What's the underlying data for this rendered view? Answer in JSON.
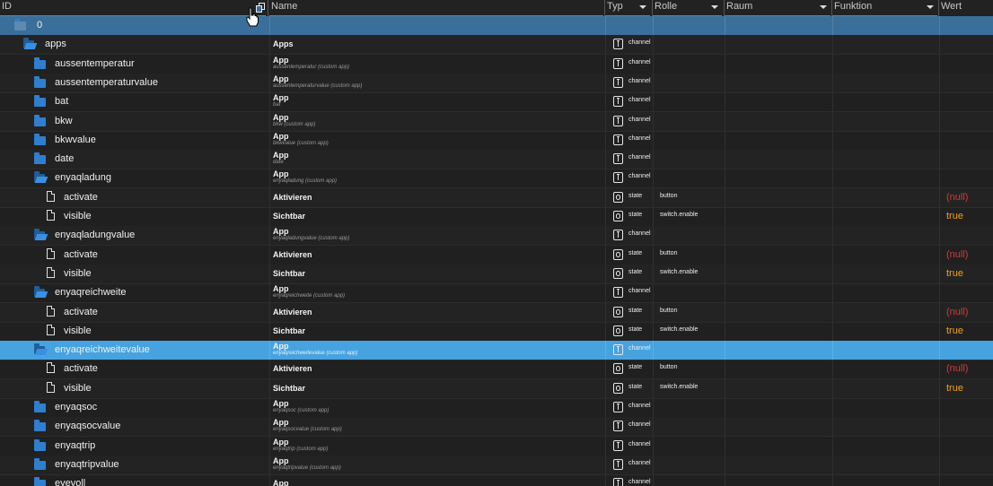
{
  "columns": {
    "id": "ID",
    "name": "Name",
    "typ": "Typ",
    "rolle": "Rolle",
    "raum": "Raum",
    "funktion": "Funktion",
    "wert": "Wert"
  },
  "colors": {
    "root_row": "#3a6f9b",
    "selected_row": "#46a3e0",
    "folder": "#2f7fcf",
    "null_value": "#d23a3a",
    "true_value": "#f0a020"
  },
  "rows": [
    {
      "id": "0",
      "icon": "folder-icon",
      "level": 0,
      "state": "root",
      "name": "",
      "sub": "",
      "type": "",
      "role": "",
      "value": ""
    },
    {
      "id": "apps",
      "icon": "folder-open-icon",
      "level": 1,
      "name": "Apps",
      "sub": "",
      "type": "channel",
      "role": "",
      "value": ""
    },
    {
      "id": "aussentemperatur",
      "icon": "folder-icon",
      "level": 2,
      "name": "App",
      "sub": "aussentemperatur (custom app)",
      "type": "channel",
      "role": "",
      "value": ""
    },
    {
      "id": "aussentemperaturvalue",
      "icon": "folder-icon",
      "level": 2,
      "name": "App",
      "sub": "aussentemperaturvalue (custom app)",
      "type": "channel",
      "role": "",
      "value": ""
    },
    {
      "id": "bat",
      "icon": "folder-icon",
      "level": 2,
      "name": "App",
      "sub": "bat",
      "type": "channel",
      "role": "",
      "value": ""
    },
    {
      "id": "bkw",
      "icon": "folder-icon",
      "level": 2,
      "name": "App",
      "sub": "bkw (custom app)",
      "type": "channel",
      "role": "",
      "value": ""
    },
    {
      "id": "bkwvalue",
      "icon": "folder-icon",
      "level": 2,
      "name": "App",
      "sub": "bkwvalue (custom app)",
      "type": "channel",
      "role": "",
      "value": ""
    },
    {
      "id": "date",
      "icon": "folder-icon",
      "level": 2,
      "name": "App",
      "sub": "date",
      "type": "channel",
      "role": "",
      "value": ""
    },
    {
      "id": "enyaqladung",
      "icon": "folder-open-icon",
      "level": 2,
      "name": "App",
      "sub": "enyaqladung (custom app)",
      "type": "channel",
      "role": "",
      "value": ""
    },
    {
      "id": "activate",
      "icon": "file-icon",
      "level": 3,
      "name": "Aktivieren",
      "sub": "",
      "type": "state",
      "role": "button",
      "value": "(null)"
    },
    {
      "id": "visible",
      "icon": "file-icon",
      "level": 3,
      "name": "Sichtbar",
      "sub": "",
      "type": "state",
      "role": "switch.enable",
      "value": "true"
    },
    {
      "id": "enyaqladungvalue",
      "icon": "folder-open-icon",
      "level": 2,
      "name": "App",
      "sub": "enyaqladungvalue (custom app)",
      "type": "channel",
      "role": "",
      "value": ""
    },
    {
      "id": "activate",
      "icon": "file-icon",
      "level": 3,
      "name": "Aktivieren",
      "sub": "",
      "type": "state",
      "role": "button",
      "value": "(null)"
    },
    {
      "id": "visible",
      "icon": "file-icon",
      "level": 3,
      "name": "Sichtbar",
      "sub": "",
      "type": "state",
      "role": "switch.enable",
      "value": "true"
    },
    {
      "id": "enyaqreichweite",
      "icon": "folder-open-icon",
      "level": 2,
      "name": "App",
      "sub": "enyaqreichweite (custom app)",
      "type": "channel",
      "role": "",
      "value": ""
    },
    {
      "id": "activate",
      "icon": "file-icon",
      "level": 3,
      "name": "Aktivieren",
      "sub": "",
      "type": "state",
      "role": "button",
      "value": "(null)"
    },
    {
      "id": "visible",
      "icon": "file-icon",
      "level": 3,
      "name": "Sichtbar",
      "sub": "",
      "type": "state",
      "role": "switch.enable",
      "value": "true"
    },
    {
      "id": "enyaqreichweitevalue",
      "icon": "folder-open-icon",
      "level": 2,
      "state": "selected",
      "name": "App",
      "sub": "enyaqreichweitevalue (custom app)",
      "type": "channel",
      "role": "",
      "value": ""
    },
    {
      "id": "activate",
      "icon": "file-icon",
      "level": 3,
      "name": "Aktivieren",
      "sub": "",
      "type": "state",
      "role": "button",
      "value": "(null)"
    },
    {
      "id": "visible",
      "icon": "file-icon",
      "level": 3,
      "name": "Sichtbar",
      "sub": "",
      "type": "state",
      "role": "switch.enable",
      "value": "true"
    },
    {
      "id": "enyaqsoc",
      "icon": "folder-icon",
      "level": 2,
      "name": "App",
      "sub": "enyaqsoc (custom app)",
      "type": "channel",
      "role": "",
      "value": ""
    },
    {
      "id": "enyaqsocvalue",
      "icon": "folder-icon",
      "level": 2,
      "name": "App",
      "sub": "enyaqsocvalue (custom app)",
      "type": "channel",
      "role": "",
      "value": ""
    },
    {
      "id": "enyaqtrip",
      "icon": "folder-icon",
      "level": 2,
      "name": "App",
      "sub": "enyaqtrip (custom app)",
      "type": "channel",
      "role": "",
      "value": ""
    },
    {
      "id": "enyaqtripvalue",
      "icon": "folder-icon",
      "level": 2,
      "name": "App",
      "sub": "enyaqtripvalue (custom app)",
      "type": "channel",
      "role": "",
      "value": ""
    },
    {
      "id": "eyevoll",
      "icon": "folder-icon",
      "level": 2,
      "name": "App",
      "sub": "",
      "type": "channel",
      "role": "",
      "value": ""
    }
  ]
}
